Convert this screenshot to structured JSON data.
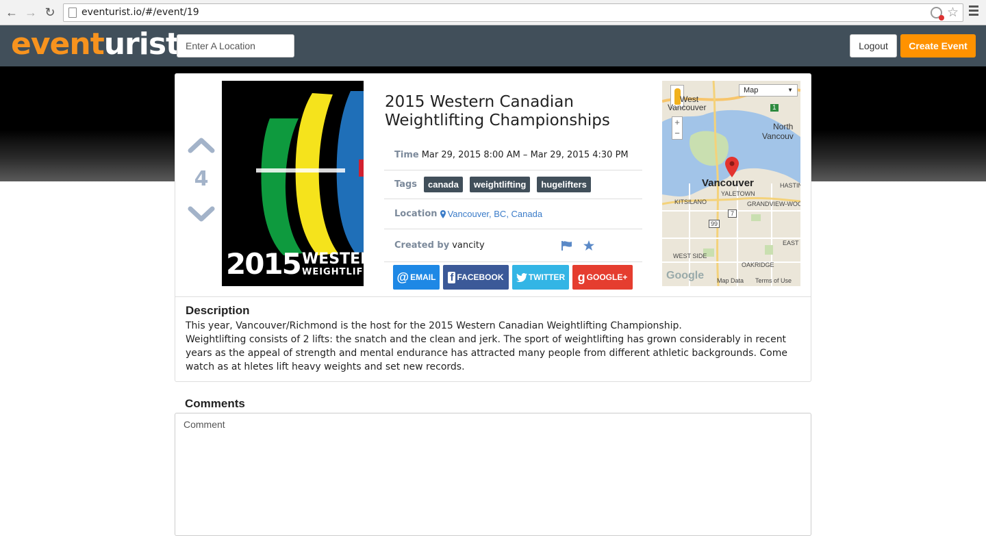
{
  "browser": {
    "url": "eventurist.io/#/event/19",
    "back_icon": "back-arrow-icon",
    "forward_icon": "forward-arrow-icon",
    "reload_icon": "reload-icon",
    "star_icon": "bookmark-star-icon",
    "menu_icon": "hamburger-menu-icon"
  },
  "header": {
    "logo_part1": "event",
    "logo_part2": "urist",
    "location_placeholder": "Enter A Location",
    "logout_label": "Logout",
    "create_event_label": "Create Event",
    "bg_color": "#414f5a",
    "accent_color": "#ff9200"
  },
  "event": {
    "votes": "4",
    "poster": {
      "year": "2015",
      "word1": "WESTER",
      "word2": "WEIGHTLIF"
    },
    "title": "2015 Western Canadian Weightlifting Championships",
    "time_label": "Time",
    "time_value": "Mar 29, 2015 8:00 AM – Mar 29, 2015 4:30 PM",
    "tags_label": "Tags",
    "tags": [
      "canada",
      "weightlifting",
      "hugelifters"
    ],
    "location_label": "Location",
    "location_value": "Vancouver, BC, Canada",
    "created_label": "Created by",
    "created_value": "vancity",
    "share": {
      "email": "EMAIL",
      "facebook": "FACEBOOK",
      "twitter": "TWITTER",
      "google": "GOOGLE+"
    }
  },
  "map": {
    "type": "Map",
    "labels": {
      "west_vancouver_1": "West",
      "west_vancouver_2": "Vancouver",
      "north_van_1": "North",
      "north_van_2": "Vancouv",
      "city": "Vancouver",
      "yaletown": "YALETOWN",
      "kitsilano": "KITSILANO",
      "grandview": "GRANDVIEW-WOOD",
      "hastings": "HASTIN",
      "west_side": "WEST SIDE",
      "oakridge": "OAKRIDGE",
      "east_s": "EAST S",
      "route1": "1",
      "route7": "7",
      "route99": "99",
      "google": "Google",
      "map_data": "Map Data",
      "terms": "Terms of Use"
    }
  },
  "description": {
    "heading": "Description",
    "line1": "This year, Vancouver/Richmond is the host for the 2015 Western Canadian Weightlifting Championship.",
    "line2": "Weightlifting consists of 2 lifts: the snatch and the clean and jerk. The sport of weightlifting has grown considerably in recent years  as the appeal of strength and mental endurance has attracted many people from different athletic backgrounds. Come watch as at hletes lift heavy weights and set new records."
  },
  "comments": {
    "heading": "Comments",
    "placeholder": "Comment"
  }
}
